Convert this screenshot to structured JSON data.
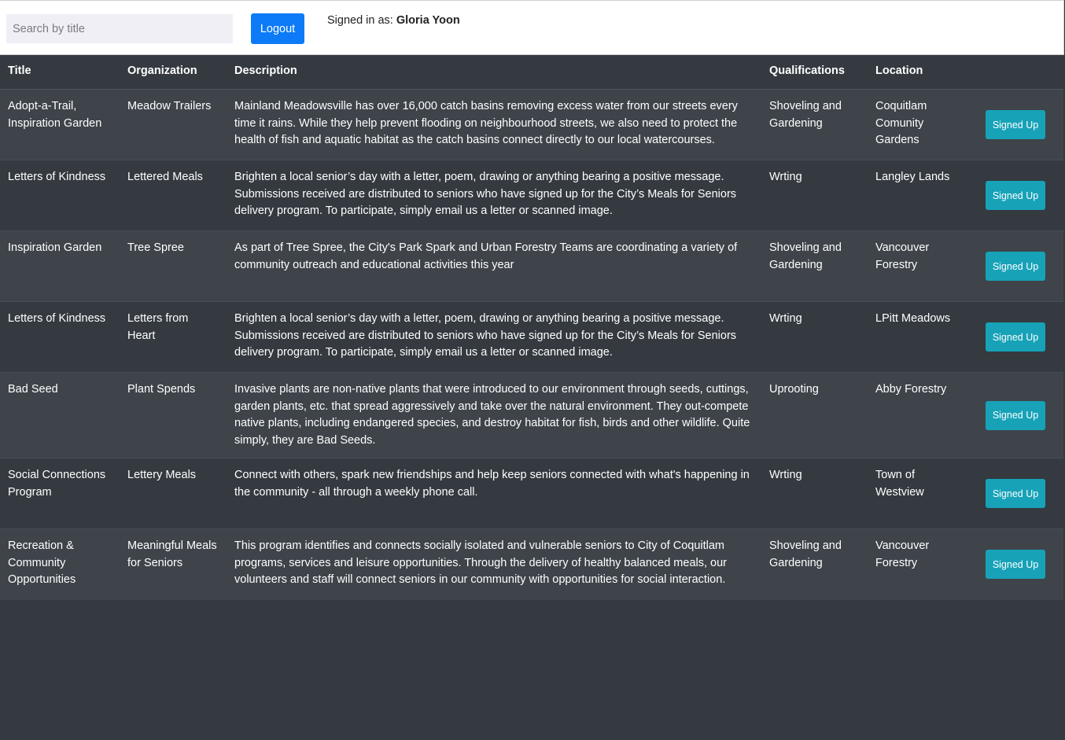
{
  "search": {
    "placeholder": "Search by title",
    "value": ""
  },
  "header": {
    "logout_label": "Logout",
    "signed_in_prefix": "Signed in as:",
    "user_name": "Gloria Yoon"
  },
  "table": {
    "columns": [
      "Title",
      "Organization",
      "Description",
      "Qualifications",
      "Location",
      ""
    ],
    "rows": [
      {
        "title": "Adopt-a-Trail, Inspiration Garden",
        "organization": "Meadow Trailers",
        "description": "Mainland Meadowsville has over 16,000 catch basins removing excess water from our streets every time it rains. While they help prevent flooding on neighbourhood streets, we also need to protect the health of fish and aquatic habitat as the catch basins connect directly to our local watercourses.",
        "qualifications": "Shoveling and Gardening",
        "location": "Coquitlam Comunity Gardens",
        "button": "Signed Up"
      },
      {
        "title": "Letters of Kindness",
        "organization": "Lettered Meals",
        "description": "Brighten a local senior’s day with a letter, poem, drawing or anything bearing a positive message. Submissions received are distributed to seniors who have signed up for the City’s Meals for Seniors delivery program. To participate, simply email us a letter or scanned image.",
        "qualifications": "Wrting",
        "location": "Langley Lands",
        "button": "Signed Up"
      },
      {
        "title": "Inspiration Garden",
        "organization": "Tree Spree",
        "description": "As part of Tree Spree, the City's Park Spark and Urban Forestry Teams are coordinating a variety of community outreach and educational activities this year",
        "qualifications": "Shoveling and Gardening",
        "location": "Vancouver Forestry",
        "button": "Signed Up"
      },
      {
        "title": "Letters of Kindness",
        "organization": "Letters from Heart",
        "description": "Brighten a local senior’s day with a letter, poem, drawing or anything bearing a positive message. Submissions received are distributed to seniors who have signed up for the City’s Meals for Seniors delivery program. To participate, simply email us a letter or scanned image.",
        "qualifications": "Wrting",
        "location": "LPitt Meadows",
        "button": "Signed Up"
      },
      {
        "title": "Bad Seed",
        "organization": "Plant Spends",
        "description": "Invasive plants are non-native plants that were introduced to our environment through seeds, cuttings, garden plants, etc. that spread aggressively and take over the natural environment. They out-compete native plants, including endangered species, and destroy habitat for fish, birds and other wildlife. Quite simply, they are Bad Seeds.",
        "qualifications": "Uprooting",
        "location": "Abby Forestry",
        "button": "Signed Up"
      },
      {
        "title": "Social Connections Program",
        "organization": "Lettery Meals",
        "description": "Connect with others, spark new friendships and help keep seniors connected with what's happening in the community - all through a weekly phone call.",
        "qualifications": "Wrting",
        "location": "Town of Westview",
        "button": "Signed Up"
      },
      {
        "title": "Recreation & Community Opportunities",
        "organization": "Meaningful Meals for Seniors",
        "description": "This program identifies and connects socially isolated and vulnerable seniors to City of Coquitlam programs, services and leisure opportunities. Through the delivery of healthy balanced meals, our volunteers and staff will connect seniors in our community with opportunities for social interaction.",
        "qualifications": "Shoveling and Gardening",
        "location": "Vancouver Forestry",
        "button": "Signed Up"
      }
    ]
  },
  "colors": {
    "page_bg": "#343a40",
    "row_alt_bg": "#3e444a",
    "logout_bg": "#0d7bf7",
    "signup_bg": "#17a2b8",
    "search_bg": "#f0eff6"
  }
}
